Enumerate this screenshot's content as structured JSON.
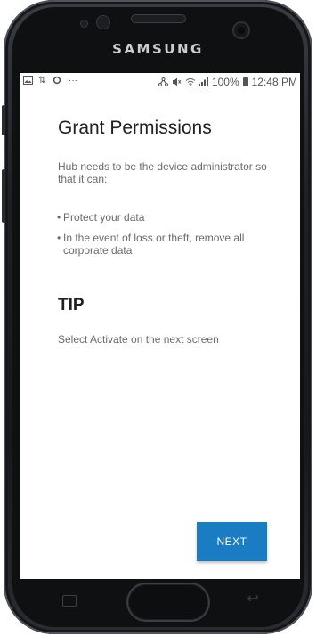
{
  "device": {
    "brand": "SAMSUNG"
  },
  "statusbar": {
    "left_icons": [
      "image-icon",
      "sync-icon",
      "settings-icon",
      "more-icon"
    ],
    "more_text": "···",
    "right_icons": [
      "data-icon",
      "mute-icon",
      "wifi-icon",
      "signal-icon"
    ],
    "battery_text": "100%",
    "time": "12:48 PM"
  },
  "page": {
    "title": "Grant Permissions",
    "description": "Hub needs to be the device administrator so that it can:",
    "bullets": [
      "Protect your data",
      "In the event of loss or theft, remove all corporate data"
    ],
    "tip_heading": "TIP",
    "tip_text": "Select Activate on the next screen"
  },
  "actions": {
    "next_label": "NEXT"
  },
  "colors": {
    "accent": "#1a7dc4",
    "title_text": "#202020",
    "body_text": "#6b6b6b",
    "screen_bg": "#ffffff"
  }
}
